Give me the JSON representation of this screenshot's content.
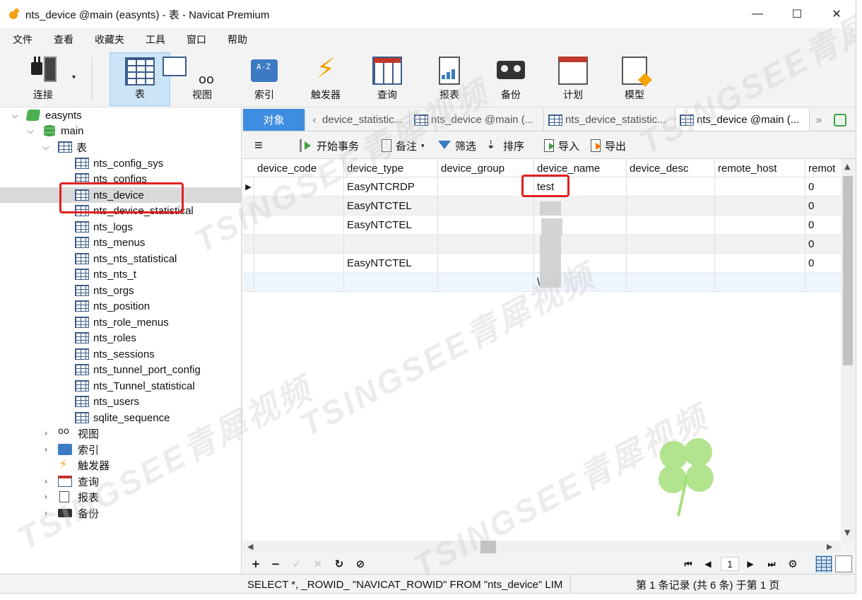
{
  "window": {
    "title": "nts_device @main (easynts) - 表 - Navicat Premium",
    "controls": {
      "minimize": "—",
      "maximize": "☐",
      "close": "✕"
    }
  },
  "menu": [
    "文件",
    "查看",
    "收藏夹",
    "工具",
    "窗口",
    "帮助"
  ],
  "toolbar": {
    "buttons": [
      {
        "label": "连接",
        "icon": "plug-icon"
      },
      {
        "label": "表",
        "icon": "table-icon",
        "active": true
      },
      {
        "label": "视图",
        "icon": "view-icon"
      },
      {
        "label": "索引",
        "icon": "index-icon"
      },
      {
        "label": "触发器",
        "icon": "trigger-icon"
      },
      {
        "label": "查询",
        "icon": "query-icon"
      },
      {
        "label": "报表",
        "icon": "report-icon"
      },
      {
        "label": "备份",
        "icon": "backup-icon"
      },
      {
        "label": "计划",
        "icon": "schedule-icon"
      },
      {
        "label": "模型",
        "icon": "model-icon"
      }
    ],
    "dropdown_arrow": "▾"
  },
  "nav": {
    "connection": "easynts",
    "database": "main",
    "tables_group": "表",
    "tables": [
      "nts_config_sys",
      "nts_configs",
      "nts_device",
      "nts_device_statistical",
      "nts_logs",
      "nts_menus",
      "nts_nts_statistical",
      "nts_nts_t",
      "nts_orgs",
      "nts_position",
      "nts_role_menus",
      "nts_roles",
      "nts_sessions",
      "nts_tunnel_port_config",
      "nts_Tunnel_statistical",
      "nts_users",
      "sqlite_sequence"
    ],
    "selected_table": "nts_device",
    "groups": [
      "视图",
      "索引",
      "触发器",
      "查询",
      "报表",
      "备份"
    ],
    "chevron_down": "⌵",
    "chevron_right": "›"
  },
  "tabs": {
    "object_tab": "对象",
    "items": [
      "device_statistic...",
      "nts_device @main (...",
      "nts_device_statistic...",
      "nts_device @main (..."
    ],
    "active_index": 3,
    "prev_arrow": "‹",
    "next_arrow": "»"
  },
  "object_toolbar": {
    "menu_icon": "≡",
    "begin_transaction": "开始事务",
    "memo": "备注",
    "filter": "筛选",
    "sort": "排序",
    "import": "导入",
    "export": "导出"
  },
  "grid": {
    "columns": [
      "device_code",
      "device_type",
      "device_group",
      "device_name",
      "device_desc",
      "remote_host",
      "remot"
    ],
    "rows": [
      {
        "device_code": "",
        "device_type": "EasyNTCRDP",
        "device_group": "",
        "device_name": "test",
        "device_desc": "",
        "remote_host": "",
        "remot": "0",
        "current": true
      },
      {
        "device_code": "",
        "device_type": "EasyNTCTEL",
        "device_group": "",
        "device_name": "",
        "device_desc": "",
        "remote_host": "",
        "remot": "0"
      },
      {
        "device_code": "",
        "device_type": "EasyNTCTEL",
        "device_group": "",
        "device_name": "",
        "device_desc": "",
        "remote_host": "",
        "remot": "0"
      },
      {
        "device_code": "",
        "device_type": "",
        "device_group": "",
        "device_name": "",
        "device_desc": "",
        "remote_host": "",
        "remot": "0"
      },
      {
        "device_code": "",
        "device_type": "EasyNTCTEL",
        "device_group": "",
        "device_name": "",
        "device_desc": "",
        "remote_host": "",
        "remot": "0"
      },
      {
        "device_code": "",
        "device_type": "",
        "device_group": "",
        "device_name": "\\",
        "device_desc": "",
        "remote_host": "",
        "remot": ""
      }
    ],
    "row_indicator": "▶"
  },
  "bottom_toolbar": {
    "add": "+",
    "delete": "−",
    "apply": "✓",
    "cancel": "✕",
    "refresh": "↻",
    "stop": "⊘",
    "first": "⏮",
    "prev": "◀",
    "page": "1",
    "next": "▶",
    "last": "⏭",
    "settings": "⚙"
  },
  "status": {
    "sql": "SELECT *, _ROWID_ \"NAVICAT_ROWID\" FROM \"nts_device\" LIM",
    "records": "第 1 条记录 (共 6 条) 于第 1 页"
  },
  "watermark": "TSINGSEE青犀视频",
  "colors": {
    "accent": "#3d8ee0",
    "active_toolbar": "#cce4f7",
    "highlight_box": "#e02020",
    "selected_row": "#d9d9d9"
  }
}
